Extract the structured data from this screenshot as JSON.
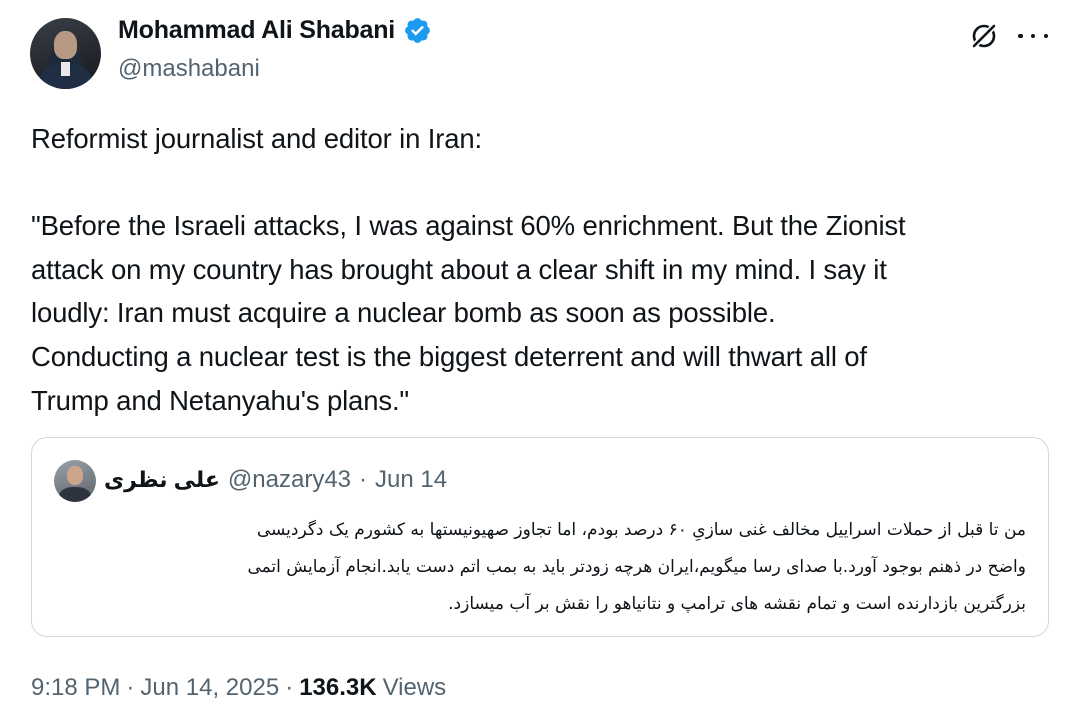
{
  "author": {
    "display_name": "Mohammad Ali Shabani",
    "handle": "@mashabani",
    "verified": true,
    "verified_color": "#1d9bf0"
  },
  "header_actions": {
    "grok_icon": "grok-icon",
    "more_icon": "more-horizontal-icon"
  },
  "tweet": {
    "lines": [
      "Reformist journalist and editor in Iran:",
      "\"Before the Israeli attacks, I was against 60% enrichment. But the Zionist",
      "attack on my country has brought about a clear shift in my mind. I say it",
      "loudly: Iran must acquire a nuclear bomb as soon as possible.",
      "Conducting a nuclear test is the biggest deterrent and will thwart all of",
      "Trump and Netanyahu's plans.\""
    ]
  },
  "quoted_tweet": {
    "display_name": "علی نظری",
    "handle": "@nazary43",
    "separator": "·",
    "date": "Jun 14",
    "lines": [
      "من تا قبل از حملات اسراییل مخالف غنی سازیِ ۶۰ درصد بودم، اما تجاوز صهیونیستها به کشورم یک دگردیسی",
      "واضح در ذهنم بوجود آورد.با صدای رسا میگویم،ایران هرچه زودتر باید به بمب اتم دست یابد.انجام آزمایش اتمی",
      "بزرگترین بازدارنده است و تمام نقشه های ترامپ و نتانیاهو را نقش بر آب میسازد."
    ]
  },
  "footer": {
    "time": "9:18 PM",
    "separator": "·",
    "date": "Jun 14, 2025",
    "views_count": "136.3K",
    "views_label": "Views"
  }
}
